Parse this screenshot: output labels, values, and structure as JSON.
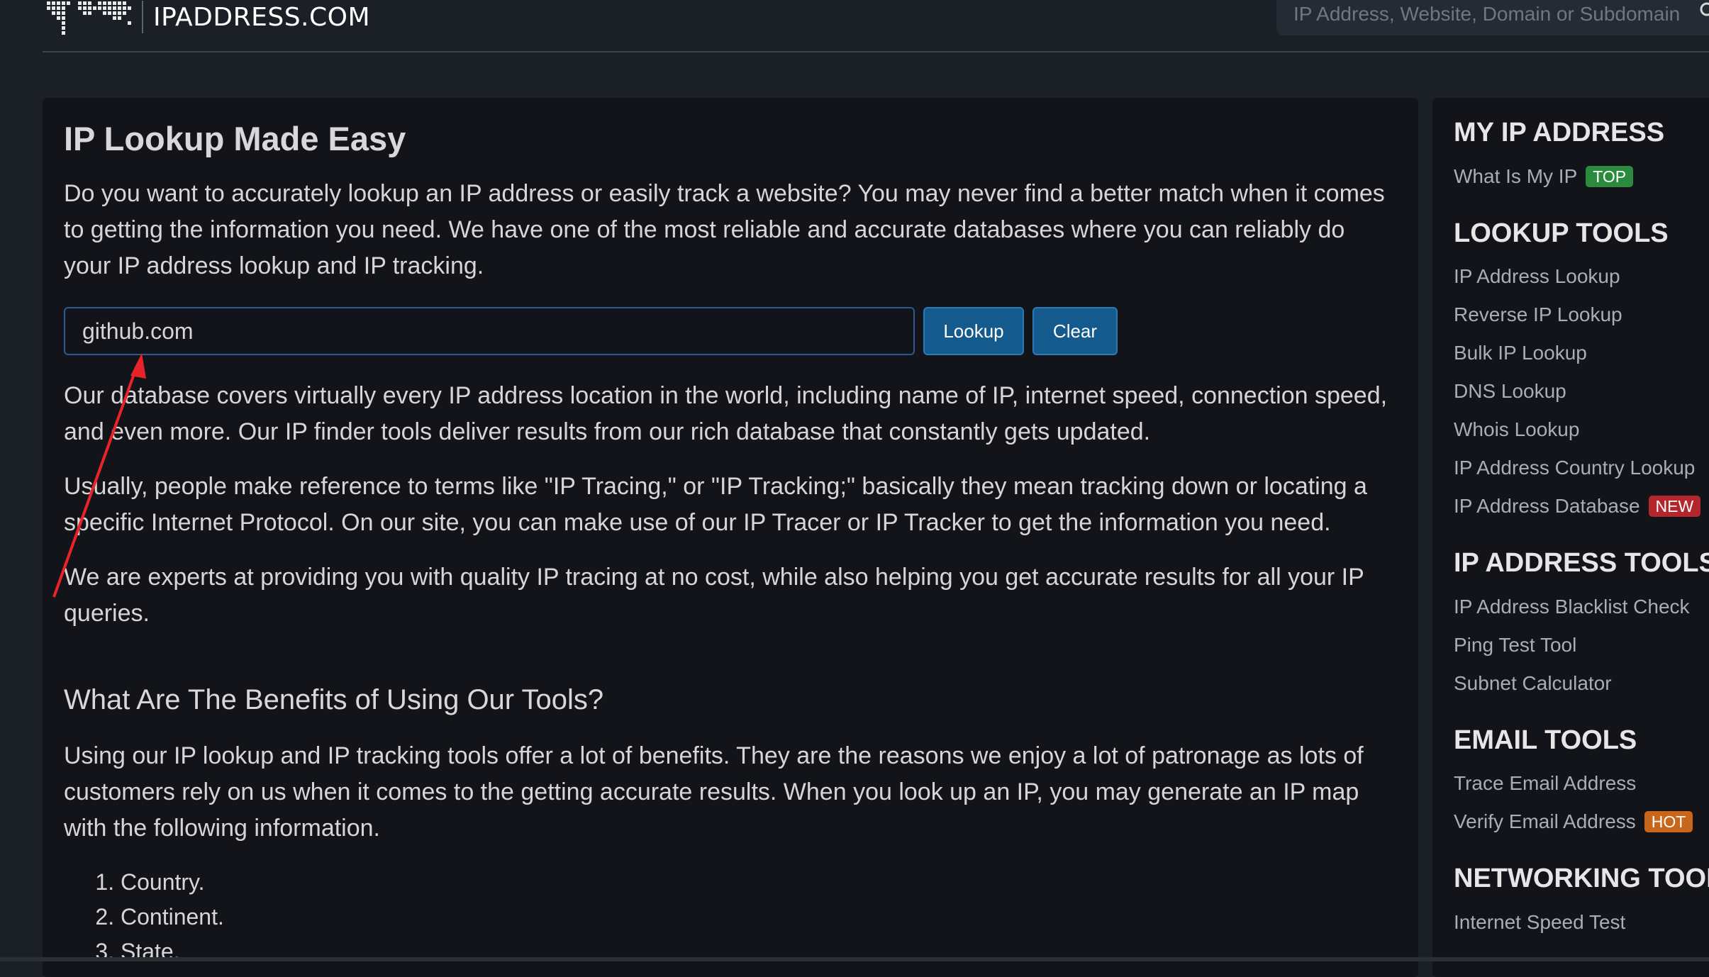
{
  "header": {
    "logo_text": "IPADDRESS.COM",
    "search_placeholder": "IP Address, Website, Domain or Subdomain"
  },
  "main": {
    "title": "IP Lookup Made Easy",
    "intro": "Do you want to accurately lookup an IP address or easily track a website? You may never find a better match when it comes to getting the information you need. We have one of the most reliable and accurate databases where you can reliably do your IP address lookup and IP tracking.",
    "lookup_input_value": "github.com",
    "lookup_button": "Lookup",
    "clear_button": "Clear",
    "paragraphs": [
      "Our database covers virtually every IP address location in the world, including name of IP, internet speed, connection speed, and even more. Our IP finder tools deliver results from our rich database that constantly gets updated.",
      "Usually, people make reference to terms like \"IP Tracing,\" or \"IP Tracking;\" basically they mean tracking down or locating a specific Internet Protocol. On our site, you can make use of our IP Tracer or IP Tracker to get the information you need.",
      "We are experts at providing you with quality IP tracing at no cost, while also helping you get accurate results for all your IP queries."
    ],
    "benefits_title": "What Are The Benefits of Using Our Tools?",
    "benefits_text": "Using our IP lookup and IP tracking tools offer a lot of benefits. They are the reasons we enjoy a lot of patronage as lots of customers rely on us when it comes to the getting accurate results. When you look up an IP, you may generate an IP map with the following information.",
    "benefits_list": [
      "Country.",
      "Continent.",
      "State."
    ]
  },
  "sidebar": {
    "sections": [
      {
        "title": "MY IP ADDRESS",
        "items": [
          {
            "label": "What Is My IP",
            "badge": "TOP"
          }
        ]
      },
      {
        "title": "LOOKUP TOOLS",
        "items": [
          {
            "label": "IP Address Lookup"
          },
          {
            "label": "Reverse IP Lookup"
          },
          {
            "label": "Bulk IP Lookup"
          },
          {
            "label": "DNS Lookup"
          },
          {
            "label": "Whois Lookup"
          },
          {
            "label": "IP Address Country Lookup"
          },
          {
            "label": "IP Address Database",
            "badge": "NEW"
          }
        ]
      },
      {
        "title": "IP ADDRESS TOOLS",
        "items": [
          {
            "label": "IP Address Blacklist Check"
          },
          {
            "label": "Ping Test Tool"
          },
          {
            "label": "Subnet Calculator"
          }
        ]
      },
      {
        "title": "EMAIL TOOLS",
        "items": [
          {
            "label": "Trace Email Address"
          },
          {
            "label": "Verify Email Address",
            "badge": "HOT"
          }
        ]
      },
      {
        "title": "NETWORKING TOOLS",
        "items": [
          {
            "label": "Internet Speed Test"
          }
        ]
      }
    ]
  },
  "colors": {
    "badge_top": "#2b8a3e",
    "badge_new": "#b3262b",
    "badge_hot": "#c8661a",
    "accent_button": "#145a8c",
    "arrow": "#e8242a"
  }
}
